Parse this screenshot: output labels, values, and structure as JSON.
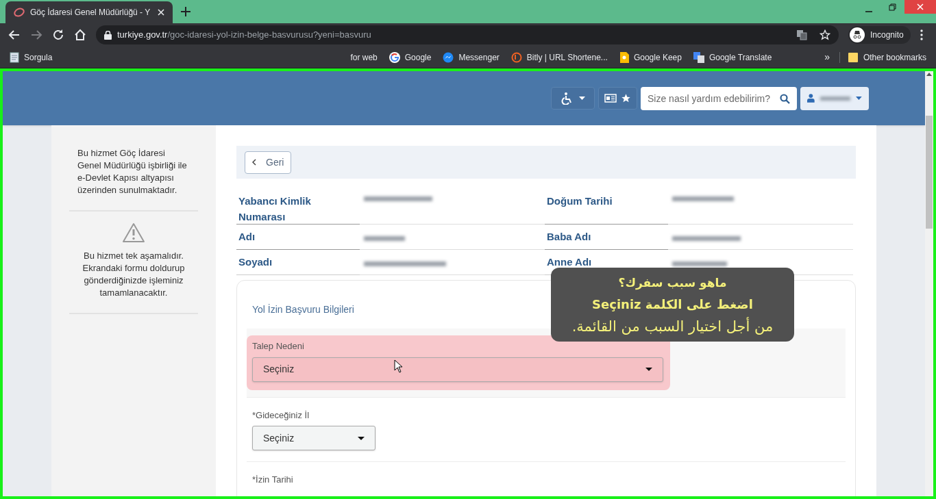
{
  "browser": {
    "tab": {
      "title": "Göç İdaresi Genel Müdürlüğü - Y"
    },
    "address": {
      "host": "turkiye.gov.tr",
      "path": "/goc-idaresi-yol-izin-belge-basvurusu?yeni=basvuru"
    },
    "profile": "Incognito",
    "bookmarks": [
      {
        "label": "Sorgula",
        "kind": "doc"
      },
      {
        "label": "for web",
        "kind": "plain"
      },
      {
        "label": "Google",
        "kind": "google"
      },
      {
        "label": "Messenger",
        "kind": "messenger"
      },
      {
        "label": "Bitly | URL Shortene...",
        "kind": "bitly"
      },
      {
        "label": "Google Keep",
        "kind": "keep"
      },
      {
        "label": "Google Translate",
        "kind": "translate"
      }
    ],
    "overflow": "»",
    "other_bookmarks": "Other bookmarks"
  },
  "header": {
    "search": {
      "placeholder": "Size nasıl yardım edebilirim?"
    }
  },
  "sidebar": {
    "notes": [
      {
        "kind": "plain",
        "text": "Bu hizmet Göç İdaresi Genel Müdürlüğü işbirliği ile e-Devlet Kapısı altyapısı üzerinden sunulmaktadır."
      },
      {
        "kind": "warning",
        "text": "Bu hizmet tek aşamalıdır. Ekrandaki formu doldurup gönderdiğinizde işleminiz tamamlanacaktır."
      }
    ]
  },
  "main": {
    "back_button": "Geri",
    "identity": [
      {
        "label": "Yabancı Kimlik Numarası"
      },
      {
        "label": "Doğum Tarihi"
      },
      {
        "label": "Adı"
      },
      {
        "label": "Baba Adı"
      },
      {
        "label": "Soyadı"
      },
      {
        "label": "Anne Adı"
      }
    ],
    "form": {
      "title": "Yol İzin Başvuru Bilgileri",
      "fields": [
        {
          "kind": "wide",
          "label": "Talep Nedeni",
          "value": "Seçiniz",
          "highlighted": true
        },
        {
          "kind": "narrow",
          "label": "*Gideceğiniz İl",
          "value": "Seçiniz",
          "highlighted": false
        },
        {
          "kind": "cut",
          "label": "*İzin Tarihi"
        }
      ]
    }
  },
  "callout": {
    "lines": [
      "ماهو سبب سفرك؟",
      "اضغط على الكلمة Seçiniz",
      "من أجل اختيار السبب من القائمة."
    ]
  }
}
